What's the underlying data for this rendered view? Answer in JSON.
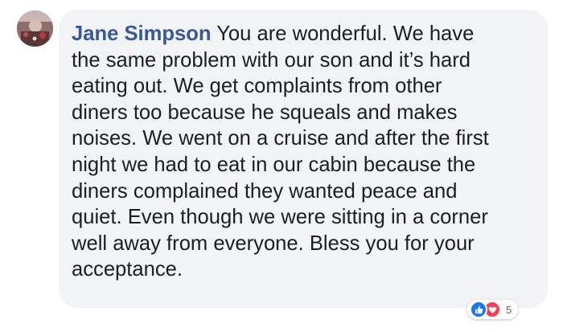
{
  "comment": {
    "author": "Jane Simpson",
    "text": "You are wonderful. We have\nthe same problem with our son and it’s hard\neating out. We get complaints from other\ndiners too because he squeals and makes\nnoises. We went on a cruise and after the first\nnight we had to eat in our cabin because the\ndiners complained they wanted peace and\nquiet. Even though we were sitting in a corner\nwell away from everyone. Bless you for your\nacceptance."
  },
  "reactions": {
    "icons": [
      "like-icon",
      "love-icon"
    ],
    "count": "5"
  },
  "colors": {
    "author": "#385898",
    "bubble": "#f2f3f5",
    "text": "#1c1e21",
    "like": "#1877f2",
    "love": "#f33e58"
  }
}
